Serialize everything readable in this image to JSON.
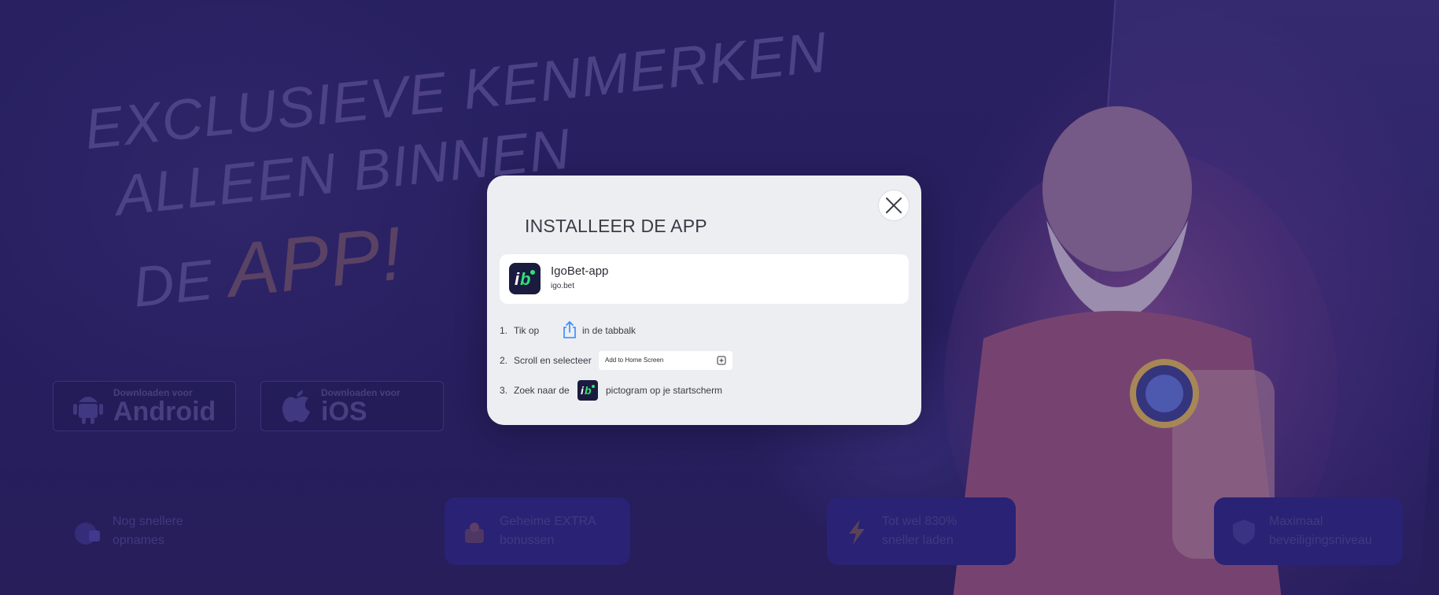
{
  "background": {
    "hero": {
      "line1": "EXCLUSIEVE KENMERKEN",
      "line2": "ALLEEN BINNEN",
      "line3": "DE",
      "accent": "APP!"
    },
    "downloads": [
      {
        "small": "Downloaden voor",
        "big": "Android",
        "icon": "android-icon"
      },
      {
        "small": "Downloaden voor",
        "big": "iOS",
        "icon": "apple-icon"
      }
    ],
    "features": [
      {
        "line1": "Nog snellere",
        "line2": "opnames",
        "icon": "speed-icon"
      },
      {
        "line1": "Geheime EXTRA",
        "line2": "bonussen",
        "icon": "cake-icon"
      },
      {
        "line1": "Tot wel 830%",
        "line2": "sneller laden",
        "icon": "lightning-icon"
      },
      {
        "line1": "Maximaal",
        "line2": "beveiligingsniveau",
        "icon": "shield-icon"
      }
    ]
  },
  "modal": {
    "title": "INSTALLEER DE APP",
    "close_icon": "close-icon",
    "app": {
      "name": "IgoBet-app",
      "domain": "igo.bet",
      "logo_text": "ib"
    },
    "steps": [
      {
        "num": "1.",
        "before": "Tik op",
        "icon": "share-icon",
        "after": "in de tabbalk"
      },
      {
        "num": "2.",
        "before": "Scroll en selecteer",
        "chip": "Add to Home Screen",
        "chip_icon": "add-square-icon"
      },
      {
        "num": "3.",
        "before": "Zoek naar de",
        "icon": "app-logo-icon",
        "after": "pictogram op je startscherm"
      }
    ]
  },
  "colors": {
    "background": "#2a2268",
    "modal_bg": "#edeef2",
    "brand_dark": "#1b1b3f",
    "brand_green": "#2fe37a",
    "share_blue": "#2f8cff"
  }
}
